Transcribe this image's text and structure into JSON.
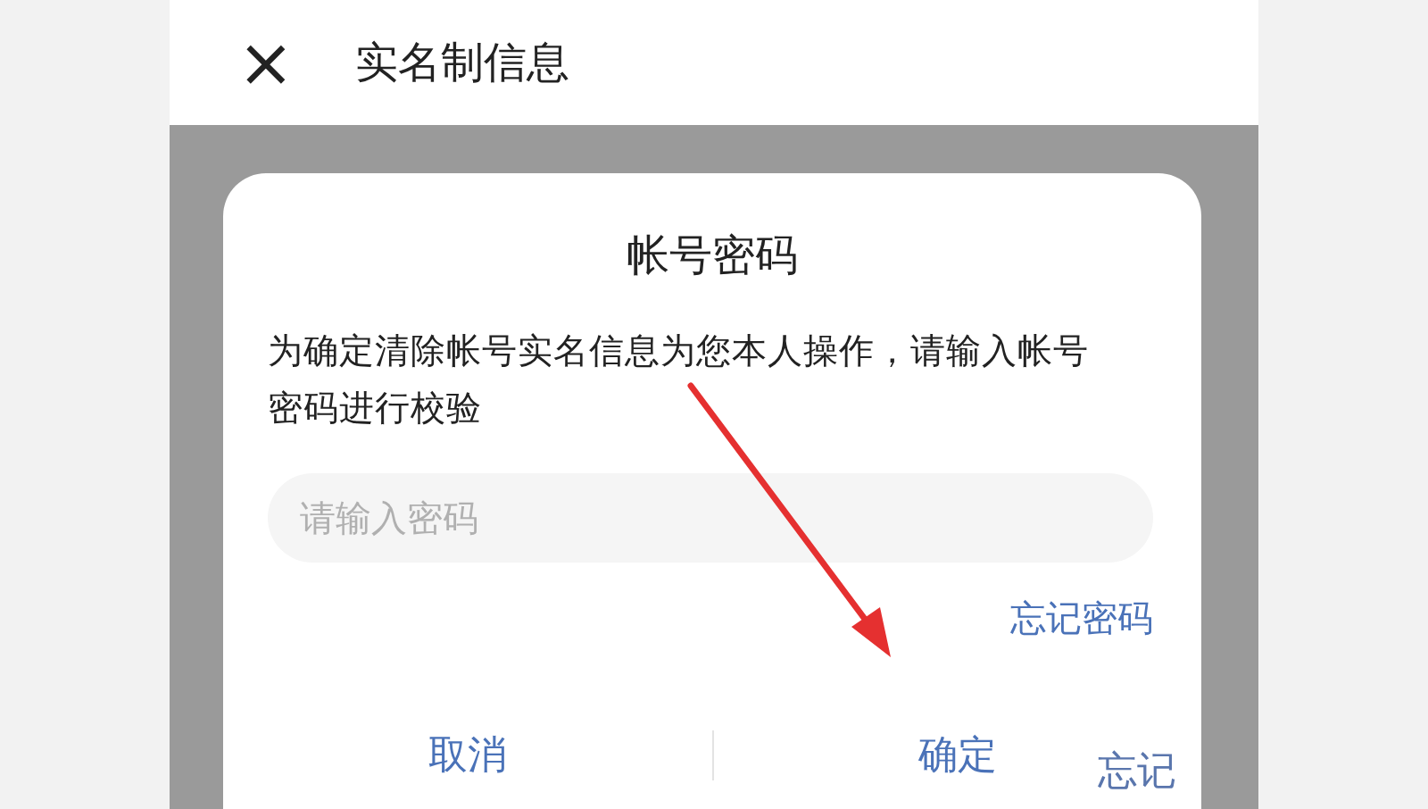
{
  "header": {
    "close": "×",
    "title": "实名制信息"
  },
  "dialog": {
    "title": "帐号密码",
    "message": "为确定清除帐号实名信息为您本人操作，请输入帐号密码进行校验",
    "password": {
      "placeholder": "请输入密码"
    },
    "forgot_link": "忘记密码",
    "buttons": [
      "取消",
      "确定"
    ]
  },
  "background_text": "忘记"
}
